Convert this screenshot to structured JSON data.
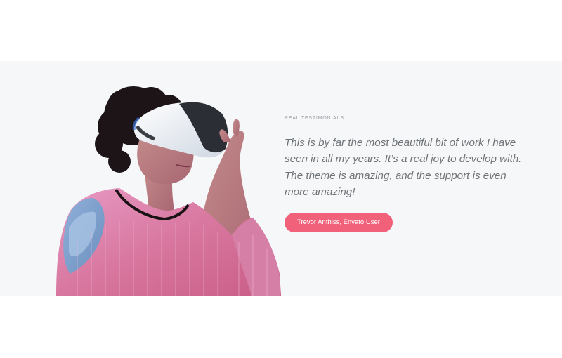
{
  "testimonial": {
    "eyebrow": "REAL TESTIMONIALS",
    "quote": "This is by far the most beautiful bit of work I have seen in all my years. It’s a real joy to develop with. The theme is amazing, and the support is even more amazing!",
    "author_button": "Trevor Anthiss, Envato User"
  },
  "image": {
    "subject": "woman-with-vr-headset"
  },
  "colors": {
    "band_background": "#f5f7f9",
    "accent": "#f2617a",
    "quote_text": "#6f7478",
    "eyebrow_text": "#9aa0a6"
  }
}
